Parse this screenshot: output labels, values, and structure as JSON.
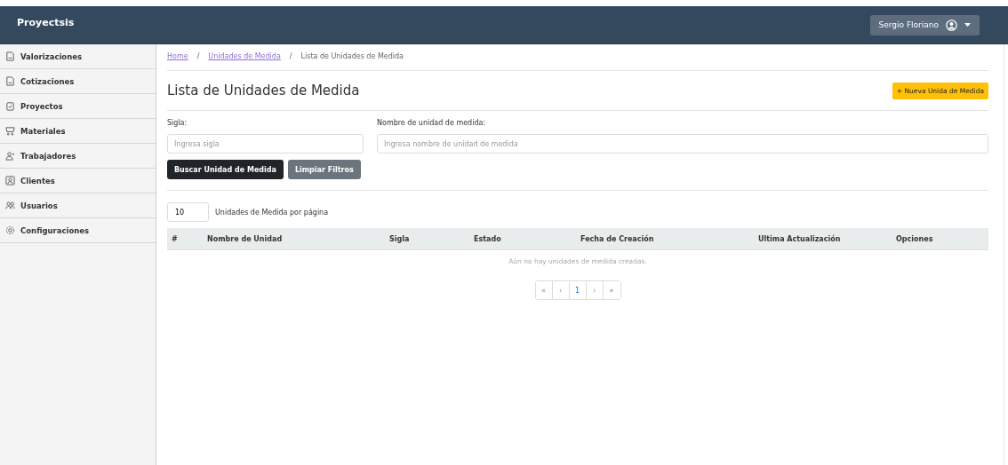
{
  "navbar": {
    "brand": "Proyectsis",
    "user": "Sergio Floriano"
  },
  "sidebar": {
    "items": [
      {
        "label": "Valorizaciones",
        "selected": false
      },
      {
        "label": "Cotizaciones",
        "selected": false
      },
      {
        "label": "Proyectos",
        "selected": false
      },
      {
        "label": "Materiales",
        "selected": false
      },
      {
        "label": "Trabajadores",
        "selected": false
      },
      {
        "label": "Clientes",
        "selected": false
      },
      {
        "label": "Usuarios",
        "selected": false
      },
      {
        "label": "Configuraciones",
        "selected": false
      }
    ]
  },
  "breadcrumb": [
    {
      "label": "Home",
      "kind": "link"
    },
    {
      "separator": "/",
      "label": "Unidades de Medida",
      "kind": "link"
    },
    {
      "separator": "/",
      "label": "Lista de Unidades de Medida",
      "kind": "current"
    }
  ],
  "page_title": "Lista de Unidades de Medida",
  "new_button": "+ Nueva Unida de Medida",
  "filters": [
    {
      "label": "Sigla:",
      "placeholder": "Ingresa sigla"
    },
    {
      "label": "Nombre de unidad de medida:",
      "placeholder": "Ingresa nombre de unidad de medida"
    }
  ],
  "search_button": "Buscar Unidad de Medida",
  "clear_button": "Limpiar Filtros",
  "per_page": {
    "value": "10",
    "label": "Unidades de Medida por página"
  },
  "table": {
    "columns": [
      "#",
      "Nombre de Unidad",
      "Sigla",
      "Estado",
      "Fecha de Creación",
      "Ultima Actualización",
      "Opciones"
    ],
    "empty_message": "Aún no hay unidades de medida creadas."
  },
  "pagination": [
    {
      "label": "«",
      "selected": false
    },
    {
      "label": "‹",
      "selected": false
    },
    {
      "label": "1",
      "selected": true
    },
    {
      "label": "›",
      "selected": false
    },
    {
      "label": "»",
      "selected": false
    }
  ]
}
